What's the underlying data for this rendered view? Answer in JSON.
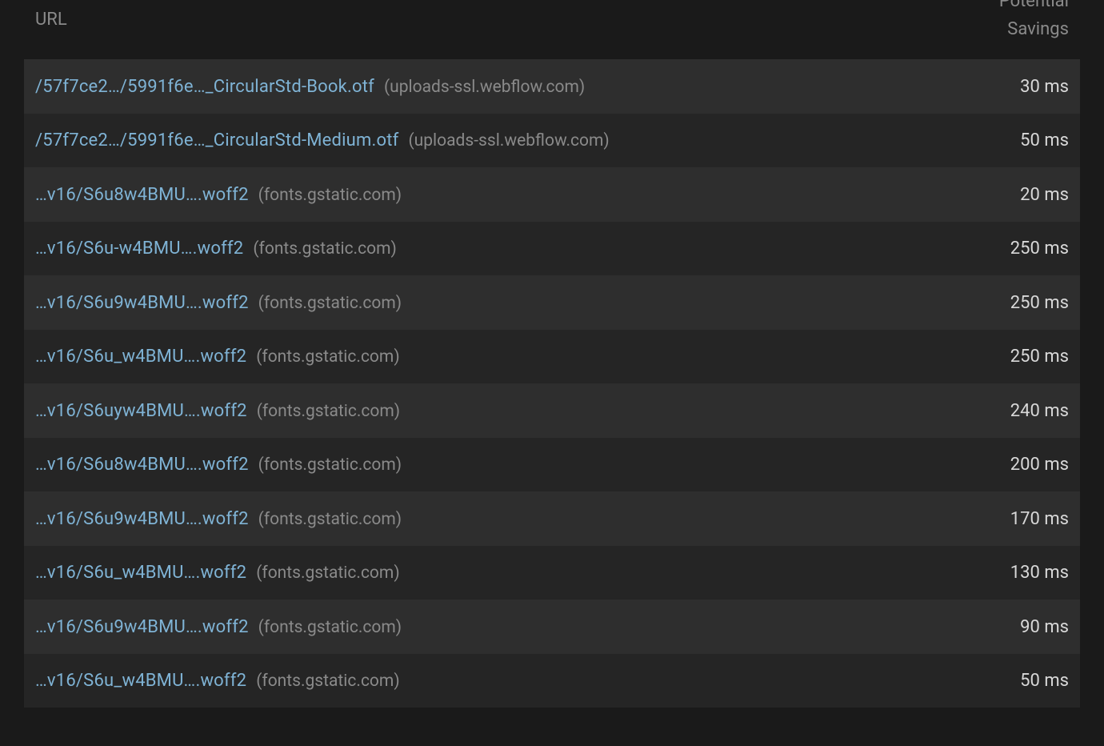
{
  "header": {
    "url_label": "URL",
    "savings_label_1": "Potential",
    "savings_label_2": "Savings"
  },
  "rows": [
    {
      "path": "/57f7ce2…/5991f6e…_CircularStd-Book.otf",
      "host": "(uploads-ssl.webflow.com)",
      "savings": "30 ms"
    },
    {
      "path": "/57f7ce2…/5991f6e…_CircularStd-Medium.otf",
      "host": "(uploads-ssl.webflow.com)",
      "savings": "50 ms"
    },
    {
      "path": "…v16/S6u8w4BMU….woff2",
      "host": "(fonts.gstatic.com)",
      "savings": "20 ms"
    },
    {
      "path": "…v16/S6u-w4BMU….woff2",
      "host": "(fonts.gstatic.com)",
      "savings": "250 ms"
    },
    {
      "path": "…v16/S6u9w4BMU….woff2",
      "host": "(fonts.gstatic.com)",
      "savings": "250 ms"
    },
    {
      "path": "…v16/S6u_w4BMU….woff2",
      "host": "(fonts.gstatic.com)",
      "savings": "250 ms"
    },
    {
      "path": "…v16/S6uyw4BMU….woff2",
      "host": "(fonts.gstatic.com)",
      "savings": "240 ms"
    },
    {
      "path": "…v16/S6u8w4BMU….woff2",
      "host": "(fonts.gstatic.com)",
      "savings": "200 ms"
    },
    {
      "path": "…v16/S6u9w4BMU….woff2",
      "host": "(fonts.gstatic.com)",
      "savings": "170 ms"
    },
    {
      "path": "…v16/S6u_w4BMU….woff2",
      "host": "(fonts.gstatic.com)",
      "savings": "130 ms"
    },
    {
      "path": "…v16/S6u9w4BMU….woff2",
      "host": "(fonts.gstatic.com)",
      "savings": "90 ms"
    },
    {
      "path": "…v16/S6u_w4BMU….woff2",
      "host": "(fonts.gstatic.com)",
      "savings": "50 ms"
    }
  ]
}
